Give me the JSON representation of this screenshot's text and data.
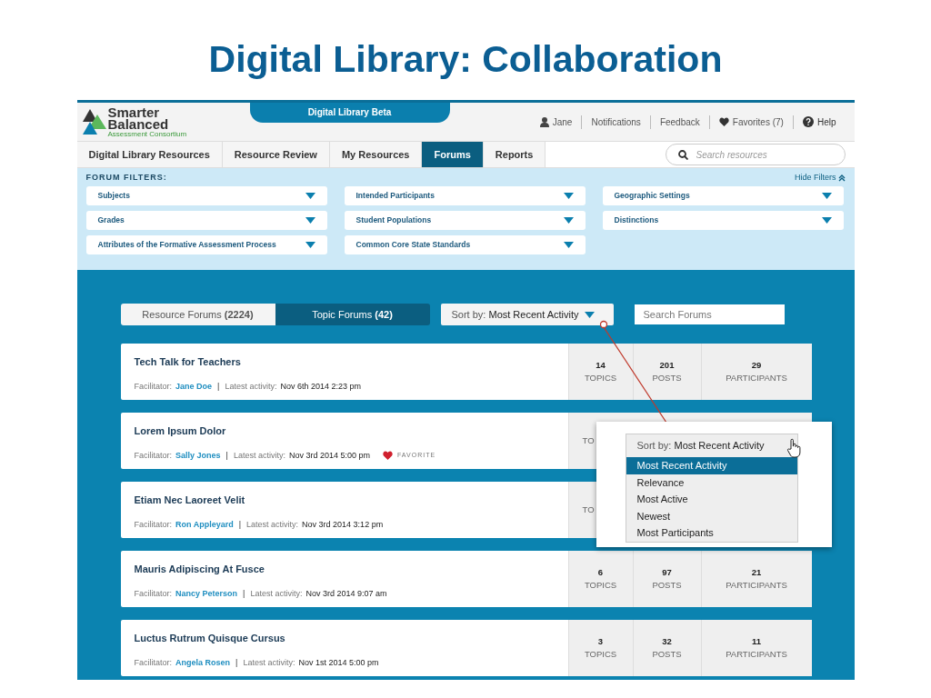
{
  "slide_title": "Digital Library: Collaboration",
  "header": {
    "logo": [
      "Smarter",
      "Balanced",
      "Assessment Consortium"
    ],
    "beta_tab": "Digital Library Beta",
    "user": "Jane",
    "links": [
      {
        "kind": "text",
        "label": "Notifications"
      },
      {
        "kind": "text",
        "label": "Feedback"
      },
      {
        "kind": "heart",
        "label": "Favorites (7)"
      },
      {
        "kind": "help",
        "label": "Help"
      }
    ]
  },
  "nav": {
    "tabs": [
      {
        "label": "Digital Library Resources",
        "selected": false
      },
      {
        "label": "Resource Review",
        "selected": false
      },
      {
        "label": "My Resources",
        "selected": false
      },
      {
        "label": "Forums",
        "selected": true
      },
      {
        "label": "Reports",
        "selected": false
      }
    ],
    "search_placeholder": "Search resources"
  },
  "filters": {
    "heading": "FORUM FILTERS:",
    "hide_label": "Hide Filters",
    "items": [
      "Subjects",
      "Intended Participants",
      "Geographic Settings",
      "Grades",
      "Student Populations",
      "Distinctions",
      "Attributes of the Formative Assessment Process",
      "Common Core State Standards"
    ]
  },
  "forums": {
    "tabs": [
      {
        "label": "Resource Forums",
        "count": "(2224)",
        "selected": false
      },
      {
        "label": "Topic Forums",
        "count": "(42)",
        "selected": true
      }
    ],
    "sort": {
      "prefix": "Sort by:",
      "value": "Most Recent Activity"
    },
    "search_placeholder": "Search Forums",
    "favorite_label": "FAVORITE",
    "rows": [
      {
        "title": "Tech Talk for Teachers",
        "facilitator_label": "Facilitator:",
        "facilitator": "Jane Doe",
        "separator": "|",
        "activity_label": "Latest activity:",
        "activity": "Nov 6th 2014 2:23 pm",
        "favorite": false,
        "stats": [
          {
            "value": "14",
            "label": "TOPICS"
          },
          {
            "value": "201",
            "label": "POSTS"
          },
          {
            "value": "29",
            "label": "PARTICIPANTS"
          }
        ]
      },
      {
        "title": "Lorem Ipsum Dolor",
        "facilitator_label": "Facilitator:",
        "facilitator": "Sally Jones",
        "separator": "|",
        "activity_label": "Latest activity:",
        "activity": "Nov 3rd 2014 5:00 pm",
        "favorite": true,
        "stats": [
          {
            "label": "TO"
          }
        ]
      },
      {
        "title": "Etiam Nec Laoreet Velit",
        "facilitator_label": "Facilitator:",
        "facilitator": "Ron Appleyard",
        "separator": "|",
        "activity_label": "Latest activity:",
        "activity": "Nov 3rd 2014 3:12 pm",
        "favorite": false,
        "stats": [
          {
            "label": "TO"
          }
        ]
      },
      {
        "title": "Mauris Adipiscing At Fusce",
        "facilitator_label": "Facilitator:",
        "facilitator": "Nancy Peterson",
        "separator": "|",
        "activity_label": "Latest activity:",
        "activity": "Nov 3rd 2014 9:07 am",
        "favorite": false,
        "stats": [
          {
            "value": "6",
            "label": "TOPICS"
          },
          {
            "value": "97",
            "label": "POSTS"
          },
          {
            "value": "21",
            "label": "PARTICIPANTS"
          }
        ]
      },
      {
        "title": "Luctus Rutrum Quisque Cursus",
        "facilitator_label": "Facilitator:",
        "facilitator": "Angela Rosen",
        "separator": "|",
        "activity_label": "Latest activity:",
        "activity": "Nov 1st 2014 5:00 pm",
        "favorite": false,
        "stats": [
          {
            "value": "3",
            "label": "TOPICS"
          },
          {
            "value": "32",
            "label": "POSTS"
          },
          {
            "value": "11",
            "label": "PARTICIPANTS"
          }
        ]
      }
    ],
    "sort_menu": {
      "prefix": "Sort by:",
      "value": "Most Recent Activity",
      "options": [
        {
          "label": "Most Recent Activity",
          "selected": true
        },
        {
          "label": "Relevance",
          "selected": false
        },
        {
          "label": "Most Active",
          "selected": false
        },
        {
          "label": "Newest",
          "selected": false
        },
        {
          "label": "Most Participants",
          "selected": false
        }
      ]
    }
  }
}
